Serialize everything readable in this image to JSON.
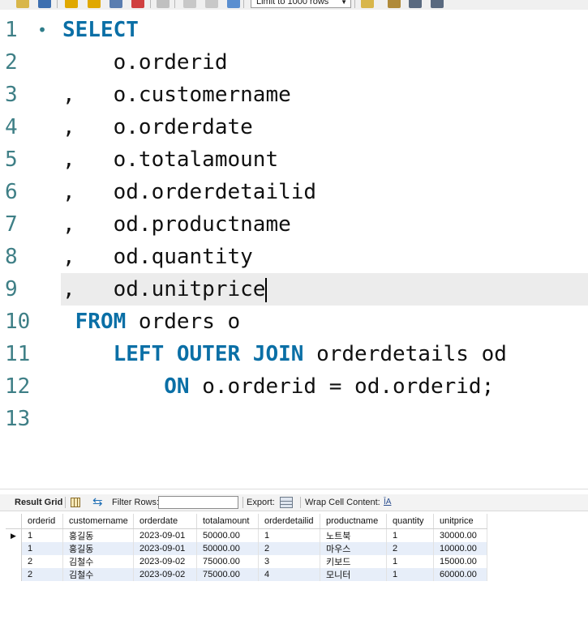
{
  "toolbar": {
    "limit_label": "Limit to 1000 rows",
    "buttons": [
      "open-folder-icon",
      "save-icon",
      "execute-icon",
      "execute-current-icon",
      "explain-icon",
      "stop-icon",
      "toggle-error-icon",
      "commit-icon",
      "rollback-icon",
      "autocommit-icon",
      "beautify-icon",
      "find-icon",
      "invisible-chars-icon",
      "wrap-icon"
    ]
  },
  "editor": {
    "lines": [
      {
        "num": "1",
        "fold": "•",
        "parts": [
          {
            "t": "SELECT",
            "kw": true
          }
        ]
      },
      {
        "num": "2",
        "parts": [
          {
            "t": "    o.orderid",
            "kw": false
          }
        ]
      },
      {
        "num": "3",
        "parts": [
          {
            "t": ",   o.customername",
            "kw": false
          }
        ]
      },
      {
        "num": "4",
        "parts": [
          {
            "t": ",   o.orderdate",
            "kw": false
          }
        ]
      },
      {
        "num": "5",
        "parts": [
          {
            "t": ",   o.totalamount",
            "kw": false
          }
        ]
      },
      {
        "num": "6",
        "parts": [
          {
            "t": ",   od.orderdetailid",
            "kw": false
          }
        ]
      },
      {
        "num": "7",
        "parts": [
          {
            "t": ",   od.productname",
            "kw": false
          }
        ]
      },
      {
        "num": "8",
        "parts": [
          {
            "t": ",   od.quantity",
            "kw": false
          }
        ]
      },
      {
        "num": "9",
        "parts": [
          {
            "t": ",   od.unitprice",
            "kw": false
          }
        ],
        "current": true
      },
      {
        "num": "10",
        "parts": [
          {
            "t": " FROM",
            "kw": true
          },
          {
            "t": " orders o",
            "kw": false
          }
        ]
      },
      {
        "num": "11",
        "parts": [
          {
            "t": "    LEFT OUTER JOIN",
            "kw": true
          },
          {
            "t": " orderdetails od",
            "kw": false
          }
        ]
      },
      {
        "num": "12",
        "parts": [
          {
            "t": "        ON",
            "kw": true
          },
          {
            "t": " o.orderid = od.orderid;",
            "kw": false
          }
        ]
      },
      {
        "num": "13",
        "parts": []
      }
    ]
  },
  "result": {
    "tab_label": "Result Grid",
    "filter_label": "Filter Rows:",
    "filter_value": "",
    "export_label": "Export:",
    "wrap_label": "Wrap Cell Content:",
    "columns": [
      "orderid",
      "customername",
      "orderdate",
      "totalamount",
      "orderdetailid",
      "productname",
      "quantity",
      "unitprice"
    ],
    "rows": [
      [
        "1",
        "홍길동",
        "2023-09-01",
        "50000.00",
        "1",
        "노트북",
        "1",
        "30000.00"
      ],
      [
        "1",
        "홍길동",
        "2023-09-01",
        "50000.00",
        "2",
        "마우스",
        "2",
        "10000.00"
      ],
      [
        "2",
        "김철수",
        "2023-09-02",
        "75000.00",
        "3",
        "키보드",
        "1",
        "15000.00"
      ],
      [
        "2",
        "김철수",
        "2023-09-02",
        "75000.00",
        "4",
        "모니터",
        "1",
        "60000.00"
      ]
    ],
    "current_row_marker": "▶"
  }
}
